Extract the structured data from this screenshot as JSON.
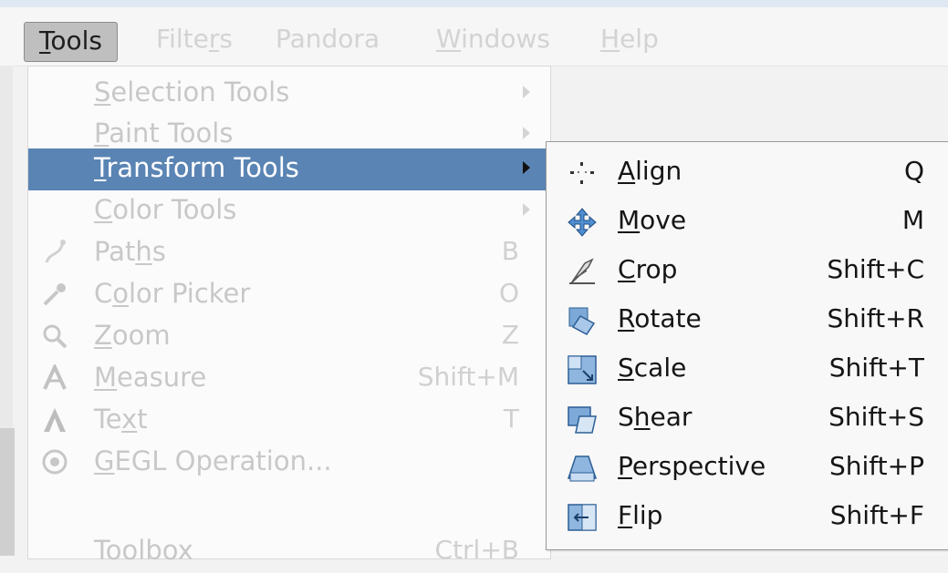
{
  "menubar": {
    "items": [
      {
        "pre": "",
        "mn": "T",
        "post": "ools"
      },
      {
        "pre": "Filte",
        "mn": "r",
        "post": "s"
      },
      {
        "pre": "Pandora",
        "mn": "",
        "post": ""
      },
      {
        "pre": "",
        "mn": "W",
        "post": "indows"
      },
      {
        "pre": "",
        "mn": "H",
        "post": "elp"
      }
    ]
  },
  "tools_menu": {
    "items": [
      {
        "pre": "",
        "mn": "S",
        "post": "election Tools",
        "shortcut": "",
        "icon": "none",
        "submenu": true
      },
      {
        "pre": "",
        "mn": "P",
        "post": "aint Tools",
        "shortcut": "",
        "icon": "none",
        "submenu": true
      },
      {
        "pre": "",
        "mn": "T",
        "post": "ransform Tools",
        "shortcut": "",
        "icon": "none",
        "submenu": true
      },
      {
        "pre": "",
        "mn": "C",
        "post": "olor Tools",
        "shortcut": "",
        "icon": "none",
        "submenu": true
      },
      {
        "pre": "Pat",
        "mn": "h",
        "post": "s",
        "shortcut": "B",
        "icon": "paths-icon",
        "submenu": false
      },
      {
        "pre": "C",
        "mn": "o",
        "post": "lor Picker",
        "shortcut": "O",
        "icon": "color-picker-icon",
        "submenu": false
      },
      {
        "pre": "",
        "mn": "Z",
        "post": "oom",
        "shortcut": "Z",
        "icon": "zoom-icon",
        "submenu": false
      },
      {
        "pre": "",
        "mn": "M",
        "post": "easure",
        "shortcut": "Shift+M",
        "icon": "measure-icon",
        "submenu": false
      },
      {
        "pre": "Te",
        "mn": "x",
        "post": "t",
        "shortcut": "T",
        "icon": "text-icon",
        "submenu": false
      },
      {
        "pre": "",
        "mn": "G",
        "post": "EGL Operation...",
        "shortcut": "",
        "icon": "gegl-icon",
        "submenu": false
      },
      {
        "pre": "Toolbox",
        "mn": "",
        "post": "",
        "shortcut": "Ctrl+B",
        "icon": "none",
        "submenu": false
      }
    ]
  },
  "transform_submenu": {
    "items": [
      {
        "pre": "",
        "mn": "A",
        "post": "lign",
        "shortcut": "Q",
        "icon": "align-icon"
      },
      {
        "pre": "",
        "mn": "M",
        "post": "ove",
        "shortcut": "M",
        "icon": "move-icon"
      },
      {
        "pre": "",
        "mn": "C",
        "post": "rop",
        "shortcut": "Shift+C",
        "icon": "crop-icon"
      },
      {
        "pre": "",
        "mn": "R",
        "post": "otate",
        "shortcut": "Shift+R",
        "icon": "rotate-icon"
      },
      {
        "pre": "",
        "mn": "S",
        "post": "cale",
        "shortcut": "Shift+T",
        "icon": "scale-icon"
      },
      {
        "pre": "S",
        "mn": "h",
        "post": "ear",
        "shortcut": "Shift+S",
        "icon": "shear-icon"
      },
      {
        "pre": "",
        "mn": "P",
        "post": "erspective",
        "shortcut": "Shift+P",
        "icon": "perspective-icon"
      },
      {
        "pre": "",
        "mn": "F",
        "post": "lip",
        "shortcut": "Shift+F",
        "icon": "flip-icon"
      }
    ]
  }
}
